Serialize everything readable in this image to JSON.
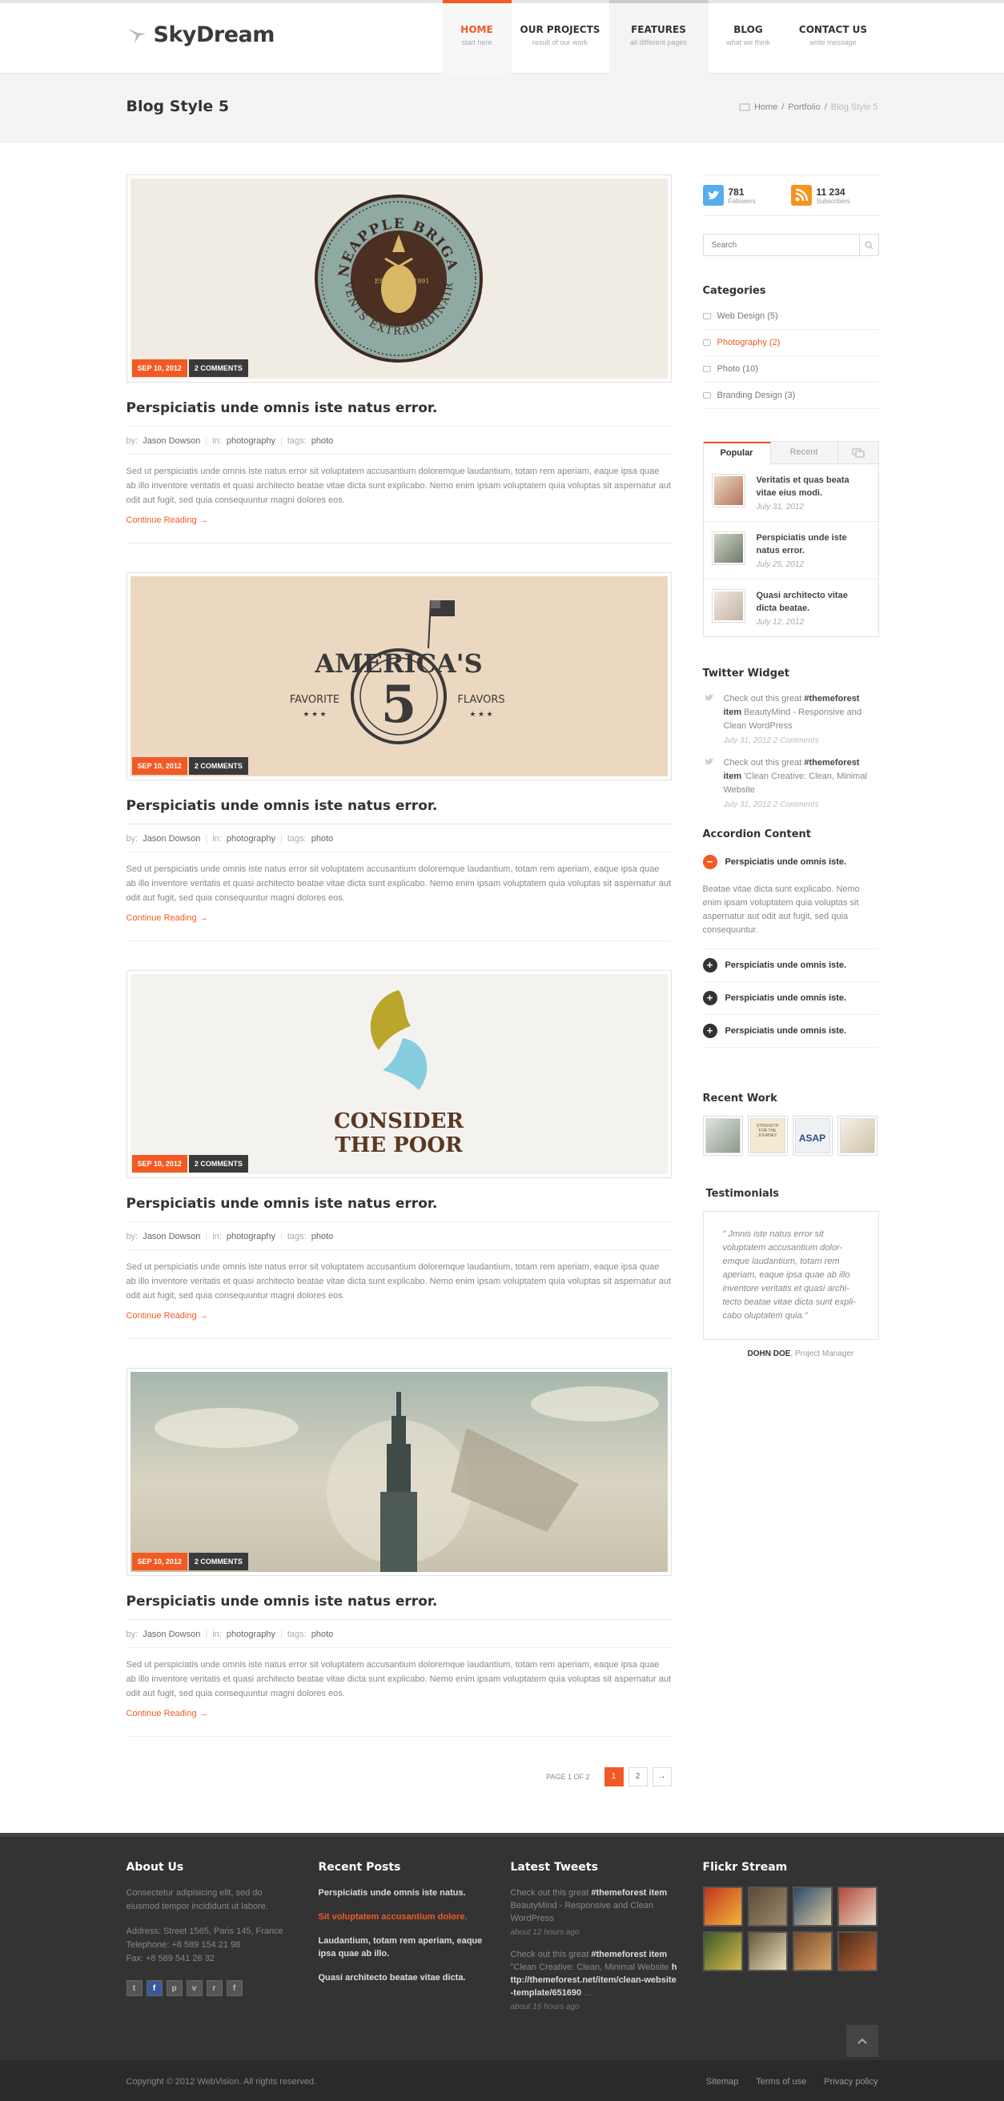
{
  "brand": {
    "name": "SkyDream"
  },
  "nav": [
    {
      "label": "HOME",
      "sub": "start here"
    },
    {
      "label": "OUR PROJECTS",
      "sub": "result of our work"
    },
    {
      "label": "FEATURES",
      "sub": "all different pages"
    },
    {
      "label": "BLOG",
      "sub": "what we think"
    },
    {
      "label": "CONTACT US",
      "sub": "write message"
    }
  ],
  "page_title": "Blog Style 5",
  "breadcrumb": {
    "home": "Home",
    "sep1": "/",
    "section": "Portfolio",
    "sep2": "/",
    "current": "Blog Style 5"
  },
  "posts": [
    {
      "date": "SEP 10, 2012",
      "comments": "2 COMMENTS",
      "title": "Perspiciatis unde omnis iste natus error.",
      "by_label": "by:",
      "author": "Jason Dowson",
      "in_label": "in:",
      "category": "photography",
      "tags_label": "tags:",
      "tags": "photo",
      "excerpt": "Sed ut perspiciatis unde omnis iste natus error sit voluptatem accusantium doloremque laudantium, totam rem aperiam, eaque ipsa quae ab illo inventore veritatis et quasi architecto beatae vitae dicta sunt explicabo. Nemo enim ipsam voluptatem quia voluptas sit aspernatur aut odit aut fugit, sed quia consequuntur magni dolores eos.",
      "more": "Continue Reading →",
      "image": {
        "top": "PINEAPPLE BRIGADE",
        "est": "EST.",
        "year": "1991",
        "bottom": "EVENTS EXTRAORDINAIRE"
      }
    },
    {
      "date": "SEP 10, 2012",
      "comments": "2 COMMENTS",
      "title": "Perspiciatis unde omnis iste natus error.",
      "by_label": "by:",
      "author": "Jason Dowson",
      "in_label": "in:",
      "category": "photography",
      "tags_label": "tags:",
      "tags": "photo",
      "excerpt": "Sed ut perspiciatis unde omnis iste natus error sit voluptatem accusantium doloremque laudantium, totam rem aperiam, eaque ipsa quae ab illo inventore veritatis et quasi architecto beatae vitae dicta sunt explicabo. Nemo enim ipsam voluptatem quia voluptas sit aspernatur aut odit aut fugit, sed quia consequuntur magni dolores eos.",
      "more": "Continue Reading →",
      "image": {
        "top": "AMERICA'S",
        "number": "5",
        "left": "FAVORITE",
        "right": "FLAVORS"
      }
    },
    {
      "date": "SEP 10, 2012",
      "comments": "2 COMMENTS",
      "title": "Perspiciatis unde omnis iste natus error.",
      "by_label": "by:",
      "author": "Jason Dowson",
      "in_label": "in:",
      "category": "photography",
      "tags_label": "tags:",
      "tags": "photo",
      "excerpt": "Sed ut perspiciatis unde omnis iste natus error sit voluptatem accusantium doloremque laudantium, totam rem aperiam, eaque ipsa quae ab illo inventore veritatis et quasi architecto beatae vitae dicta sunt explicabo. Nemo enim ipsam voluptatem quia voluptas sit aspernatur aut odit aut fugit, sed quia consequuntur magni dolores eos.",
      "more": "Continue Reading →",
      "image": {
        "line1": "CONSIDER",
        "line2": "THE POOR"
      }
    },
    {
      "date": "SEP 10, 2012",
      "comments": "2 COMMENTS",
      "title": "Perspiciatis unde omnis iste natus error.",
      "by_label": "by:",
      "author": "Jason Dowson",
      "in_label": "in:",
      "category": "photography",
      "tags_label": "tags:",
      "tags": "photo",
      "excerpt": "Sed ut perspiciatis unde omnis iste natus error sit voluptatem accusantium doloremque laudantium, totam rem aperiam, eaque ipsa quae ab illo inventore veritatis et quasi architecto beatae vitae dicta sunt explicabo. Nemo enim ipsam voluptatem quia voluptas sit aspernatur aut odit aut fugit, sed quia consequuntur magni dolores eos.",
      "more": "Continue Reading →",
      "image": {}
    }
  ],
  "pagination": {
    "label": "PAGE 1 OF 2",
    "pages": [
      "1",
      "2"
    ],
    "next": "→"
  },
  "sidebar": {
    "twitter": {
      "count": "781",
      "label": "Followers"
    },
    "rss": {
      "count": "11 234",
      "label": "Subscribers"
    },
    "search_placeholder": "Search",
    "categories_title": "Categories",
    "categories": [
      "Web Design (5)",
      "Photography (2)",
      "Photo (10)",
      "Branding Design (3)"
    ],
    "tabs": [
      "Popular",
      "Recent"
    ],
    "popular": [
      {
        "title": "Veritatis et quas beata vitae eius modi.",
        "date": "July 31, 2012"
      },
      {
        "title": "Perspiciatis unde iste natus error.",
        "date": "July 25, 2012"
      },
      {
        "title": "Quasi architecto vitae dicta beatae.",
        "date": "July 12, 2012"
      }
    ],
    "twitter_title": "Twitter Widget",
    "tweets": [
      {
        "pre": "Check out this great ",
        "bold": "#themeforest item",
        "post": " BeautyMind - Responsive and Clean WordPress",
        "time": "July 31, 2012 2 Comments"
      },
      {
        "pre": "Check out this great ",
        "bold": "#themeforest item",
        "post": " 'Clean Creative: Clean, Minimal Website",
        "time": "July 31, 2012 2 Comments"
      }
    ],
    "accordion_title": "Accordion Content",
    "accordion": [
      "Perspiciatis unde omnis iste.",
      "Perspiciatis unde omnis iste.",
      "Perspiciatis unde omnis iste.",
      "Perspiciatis unde omnis iste."
    ],
    "accordion_body": "Beatae vitae dicta sunt explicabo. Nemo enim ipsam voluptatem quia voluptas sit aspernatur aut odit aut fugit, sed quia consequuntur.",
    "recent_work_title": "Recent Work",
    "recent_work": {
      "w2": "STRENGTH FOR THE JOURNEY",
      "w3": "ASAP"
    },
    "testimonials_title": "Testimonials",
    "testimonial": {
      "quote": "\" Jmnis iste natus error sit voluptatem accusantium dolor-emque laudantium, totam rem aperiam, eaque ipsa quae ab illo inventore veritatis et quasi archi-tecto beatae vitae dicta sunt expli-cabo oluptatem quia.\"",
      "name": "DOHN DOE",
      "role": ", Project Manager"
    }
  },
  "footer": {
    "about_title": "About Us",
    "about_text": "Consectetur adipisicing elit, sed do eiusmod tempor incididunt ut labore.",
    "address": "Address: Street 1565, Paris 145, France",
    "telephone": "Telephone: +8 589 154 21 98",
    "fax": "Fax: +8 589 541 26 32",
    "social": [
      "t",
      "f",
      "p",
      "v",
      "r",
      "f"
    ],
    "recent_title": "Recent Posts",
    "recent_posts": [
      "Perspiciatis unde omnis iste natus.",
      "Sit voluptatem accusantium dolore.",
      "Laudantium, totam rem aperiam, eaque ipsa quae ab illo.",
      "Quasi architecto beatae vitae dicta."
    ],
    "tweets_title": "Latest Tweets",
    "tweets": [
      {
        "pre": "Check out this great ",
        "bold": "#themeforest item",
        "post": " BeautyMind - Responsive and Clean WordPress",
        "time": "about 12 hours ago"
      },
      {
        "pre": "Check out this great ",
        "bold": "#themeforest item",
        "post": " \"Clean Creative: Clean, Minimal Website",
        "link": "http://themeforest.net/item/clean-website-template/651690",
        "ellipsis": " ...",
        "time": "about 16 hours ago"
      }
    ],
    "flickr_title": "Flickr Stream",
    "copyright": "Copyright © 2012 WebVision. All rights reserved.",
    "links": [
      "Sitemap",
      "Terms of use",
      "Privacy policy"
    ]
  },
  "colors": {
    "accent": "#f15a24",
    "footer_bg": "#333333",
    "dark_badge": "#3a3a3a"
  }
}
